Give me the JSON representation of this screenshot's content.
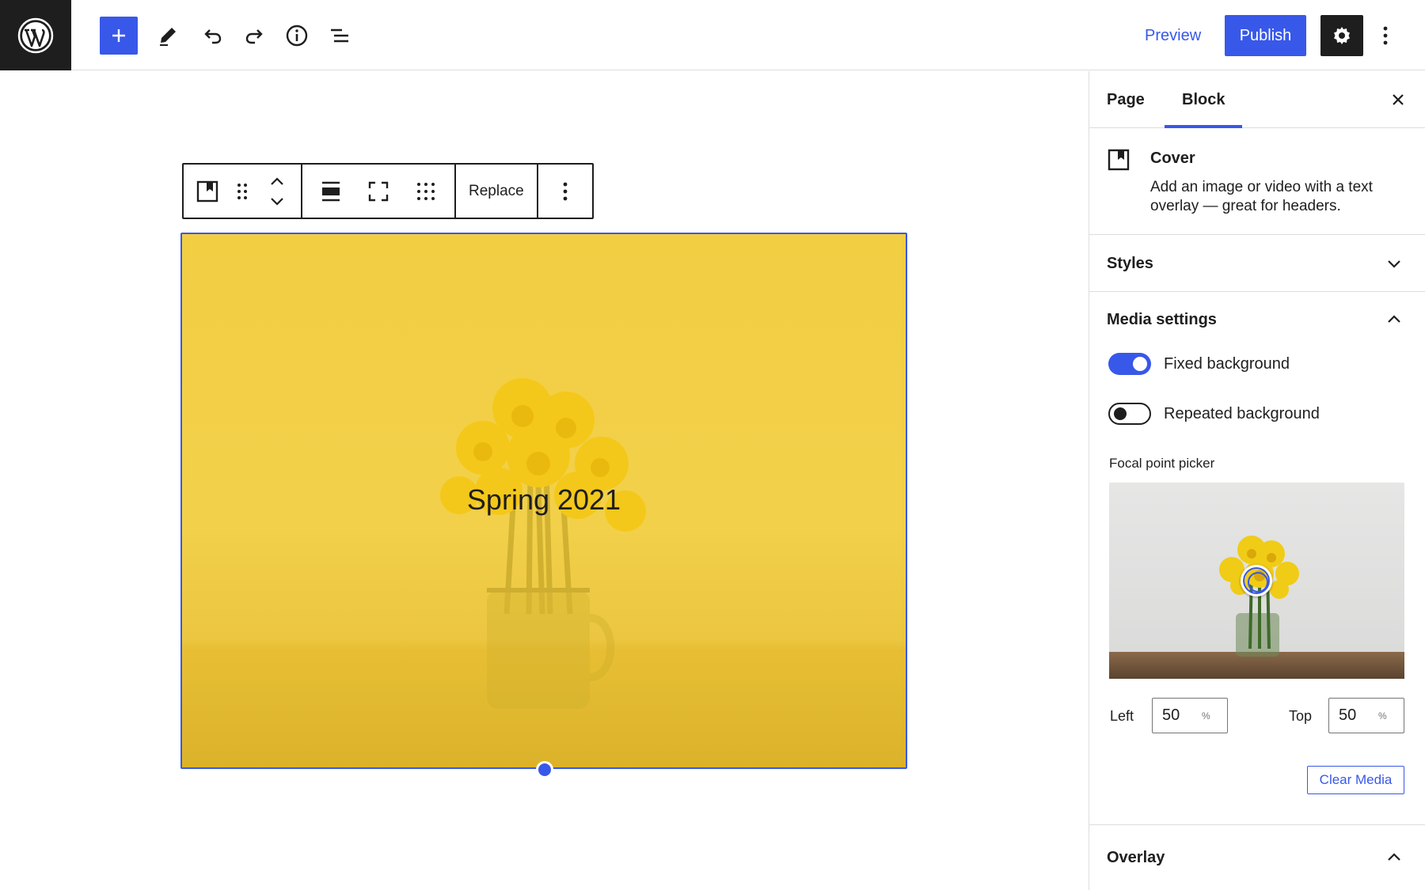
{
  "topbar": {
    "preview_label": "Preview",
    "publish_label": "Publish"
  },
  "block_toolbar": {
    "replace_label": "Replace"
  },
  "cover": {
    "title": "Spring 2021",
    "overlay_color": "#f2d04a"
  },
  "sidebar": {
    "tabs": [
      {
        "label": "Page",
        "active": false
      },
      {
        "label": "Block",
        "active": true
      }
    ],
    "block_card": {
      "title": "Cover",
      "description": "Add an image or video with a text overlay — great for headers."
    },
    "panels": {
      "styles": "Styles",
      "media_settings": "Media settings",
      "overlay": "Overlay"
    },
    "toggles": [
      {
        "label": "Fixed background",
        "on": true
      },
      {
        "label": "Repeated background",
        "on": false
      }
    ],
    "focal_point": {
      "label": "Focal point picker",
      "left_label": "Left",
      "left_value": "50",
      "top_label": "Top",
      "top_value": "50",
      "unit": "%"
    },
    "clear_media_label": "Clear Media"
  },
  "colors": {
    "accent": "#3858e9",
    "dark": "#1e1e1e"
  }
}
